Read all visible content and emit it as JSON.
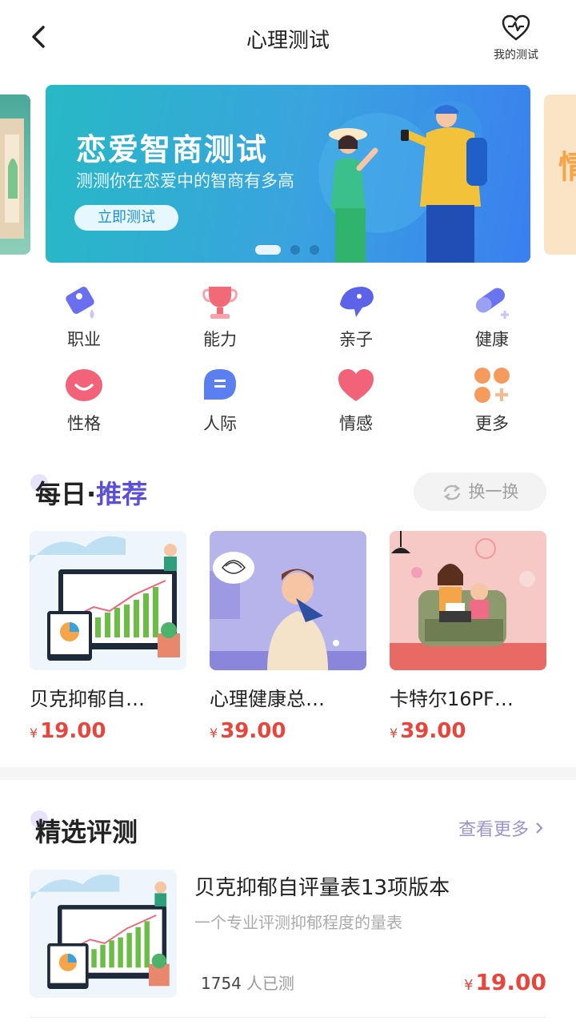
{
  "header": {
    "title": "心理测试",
    "my_test_label": "我的测试"
  },
  "banner": {
    "title": "恋爱智商测试",
    "subtitle": "测测你在恋爱中的智商有多高",
    "button_label": "立即测试",
    "right_card_text": "情",
    "active_dot": 0,
    "dot_count": 3
  },
  "categories": [
    {
      "label": "职业",
      "icon": "career-icon"
    },
    {
      "label": "能力",
      "icon": "trophy-icon"
    },
    {
      "label": "亲子",
      "icon": "parenting-icon"
    },
    {
      "label": "健康",
      "icon": "pill-icon"
    },
    {
      "label": "性格",
      "icon": "smile-icon"
    },
    {
      "label": "人际",
      "icon": "chat-icon"
    },
    {
      "label": "情感",
      "icon": "heart-icon"
    },
    {
      "label": "更多",
      "icon": "more-icon"
    }
  ],
  "daily": {
    "title_main": "每日",
    "title_sep": "·",
    "title_accent": "推荐",
    "refresh_label": "换一换",
    "products": [
      {
        "name": "贝克抑郁自…",
        "currency": "¥",
        "price": "19.00"
      },
      {
        "name": "心理健康总…",
        "currency": "¥",
        "price": "39.00"
      },
      {
        "name": "卡特尔16PF…",
        "currency": "¥",
        "price": "39.00"
      }
    ]
  },
  "selected": {
    "title": "精选评测",
    "see_more": "查看更多",
    "items": [
      {
        "title": "贝克抑郁自评量表13项版本",
        "desc": "一个专业评测抑郁程度的量表",
        "count": "1754",
        "count_unit": "人已测",
        "currency": "¥",
        "price": "19.00"
      }
    ]
  },
  "colors": {
    "accent": "#5b4fd8",
    "price": "#e8453c",
    "banner_start": "#27b9c5",
    "banner_end": "#3a7ff0"
  }
}
